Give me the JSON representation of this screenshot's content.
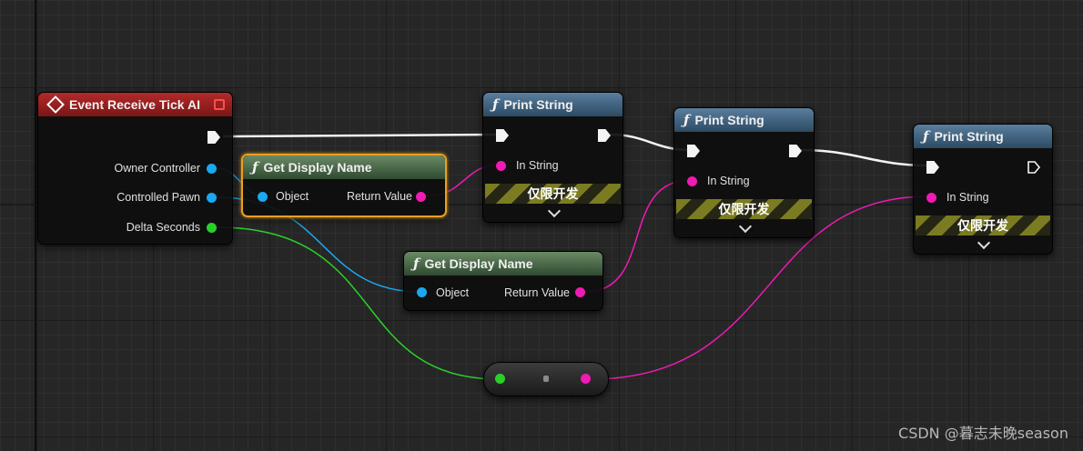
{
  "colors": {
    "exec_wire": "#f4f4f4",
    "object_wire": "#1aa8f0",
    "string_wire": "#f01ab4",
    "float_wire": "#2ad02a",
    "selection_outline": "#e8a020",
    "event_header": "#9a2020",
    "function_header": "#3e6480",
    "pure_function_header": "#4a6a48"
  },
  "nodes": {
    "event_tick": {
      "title": "Event Receive Tick AI",
      "icon": "event-diamond-icon",
      "pins": {
        "owner_controller": "Owner Controller",
        "controlled_pawn": "Controlled Pawn",
        "delta_seconds": "Delta Seconds"
      }
    },
    "get_display_name_1": {
      "title": "Get Display Name",
      "icon": "function-f-icon",
      "selected": true,
      "input": "Object",
      "output": "Return Value"
    },
    "get_display_name_2": {
      "title": "Get Display Name",
      "icon": "function-f-icon",
      "input": "Object",
      "output": "Return Value"
    },
    "print_string_1": {
      "title": "Print String",
      "icon": "function-f-icon",
      "in_string": "In String",
      "dev_only": "仅限开发"
    },
    "print_string_2": {
      "title": "Print String",
      "icon": "function-f-icon",
      "in_string": "In String",
      "dev_only": "仅限开发"
    },
    "print_string_3": {
      "title": "Print String",
      "icon": "function-f-icon",
      "in_string": "In String",
      "dev_only": "仅限开发"
    }
  },
  "conversion_node": {
    "icon": "float-to-string-conversion-icon"
  },
  "watermark": "CSDN @暮志未晚season"
}
